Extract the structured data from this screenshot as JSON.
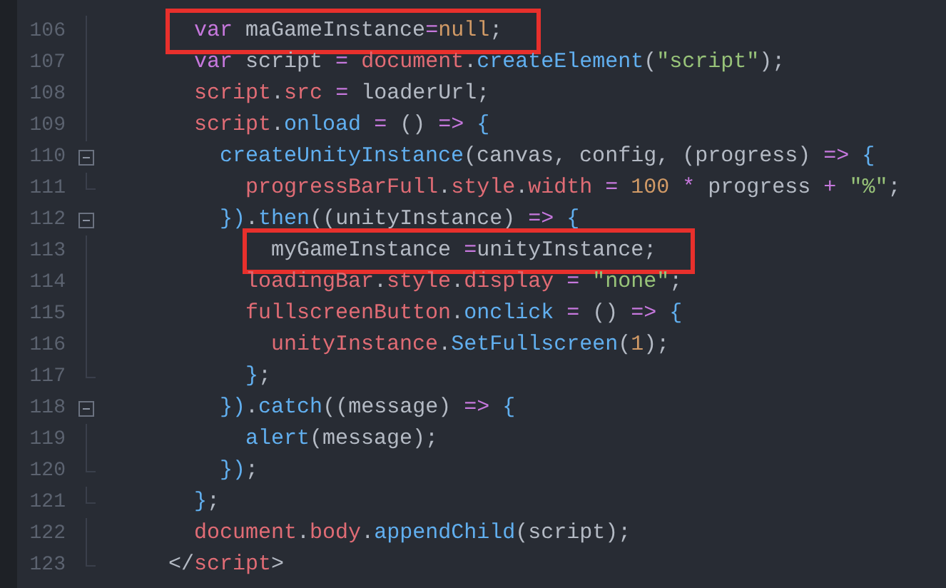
{
  "editor": {
    "lines": [
      {
        "number": "106",
        "kind": "line",
        "boxed": true,
        "tokens": [
          {
            "kind": "kw",
            "text": "      var"
          },
          {
            "kind": "plain",
            "text": " maGameInstance"
          },
          {
            "kind": "op",
            "text": "="
          },
          {
            "kind": "num",
            "text": "null"
          },
          {
            "kind": "plain",
            "text": ";"
          }
        ]
      },
      {
        "number": "107",
        "kind": "line",
        "boxed": false,
        "tokens": [
          {
            "kind": "kw",
            "text": "      var"
          },
          {
            "kind": "plain",
            "text": " script "
          },
          {
            "kind": "op",
            "text": "="
          },
          {
            "kind": "var",
            "text": " document"
          },
          {
            "kind": "plain",
            "text": "."
          },
          {
            "kind": "fn",
            "text": "createElement"
          },
          {
            "kind": "plain",
            "text": "("
          },
          {
            "kind": "str",
            "text": "\"script\""
          },
          {
            "kind": "plain",
            "text": ");"
          }
        ]
      },
      {
        "number": "108",
        "kind": "line",
        "boxed": false,
        "tokens": [
          {
            "kind": "var",
            "text": "      script"
          },
          {
            "kind": "plain",
            "text": "."
          },
          {
            "kind": "var",
            "text": "src"
          },
          {
            "kind": "op",
            "text": " ="
          },
          {
            "kind": "plain",
            "text": " loaderUrl;"
          }
        ]
      },
      {
        "number": "109",
        "kind": "line",
        "boxed": false,
        "tokens": [
          {
            "kind": "var",
            "text": "      script"
          },
          {
            "kind": "plain",
            "text": "."
          },
          {
            "kind": "fn",
            "text": "onload"
          },
          {
            "kind": "op",
            "text": " ="
          },
          {
            "kind": "plain",
            "text": " () "
          },
          {
            "kind": "op",
            "text": "=>"
          },
          {
            "kind": "fn",
            "text": " {"
          }
        ]
      },
      {
        "number": "110",
        "kind": "fold",
        "boxed": false,
        "tokens": [
          {
            "kind": "fn",
            "text": "        createUnityInstance"
          },
          {
            "kind": "plain",
            "text": "(canvas, config, (progress) "
          },
          {
            "kind": "op",
            "text": "=>"
          },
          {
            "kind": "fn",
            "text": " {"
          }
        ]
      },
      {
        "number": "111",
        "kind": "end",
        "boxed": false,
        "tokens": [
          {
            "kind": "var",
            "text": "          progressBarFull"
          },
          {
            "kind": "plain",
            "text": "."
          },
          {
            "kind": "var",
            "text": "style"
          },
          {
            "kind": "plain",
            "text": "."
          },
          {
            "kind": "var",
            "text": "width"
          },
          {
            "kind": "op",
            "text": " ="
          },
          {
            "kind": "num",
            "text": " 100"
          },
          {
            "kind": "op",
            "text": " *"
          },
          {
            "kind": "plain",
            "text": " progress "
          },
          {
            "kind": "op",
            "text": "+"
          },
          {
            "kind": "str",
            "text": " \"%\""
          },
          {
            "kind": "plain",
            "text": ";"
          }
        ]
      },
      {
        "number": "112",
        "kind": "fold",
        "boxed": false,
        "tokens": [
          {
            "kind": "fn",
            "text": "        })"
          },
          {
            "kind": "plain",
            "text": "."
          },
          {
            "kind": "fn",
            "text": "then"
          },
          {
            "kind": "plain",
            "text": "((unityInstance) "
          },
          {
            "kind": "op",
            "text": "=>"
          },
          {
            "kind": "fn",
            "text": " {"
          }
        ]
      },
      {
        "number": "113",
        "kind": "line",
        "boxed": true,
        "tokens": [
          {
            "kind": "plain",
            "text": "            myGameInstance "
          },
          {
            "kind": "op",
            "text": "="
          },
          {
            "kind": "plain",
            "text": "unityInstance;"
          }
        ]
      },
      {
        "number": "114",
        "kind": "line",
        "boxed": false,
        "tokens": [
          {
            "kind": "var",
            "text": "          loadingBar"
          },
          {
            "kind": "plain",
            "text": "."
          },
          {
            "kind": "var",
            "text": "style"
          },
          {
            "kind": "plain",
            "text": "."
          },
          {
            "kind": "var",
            "text": "display"
          },
          {
            "kind": "op",
            "text": " ="
          },
          {
            "kind": "str",
            "text": " \"none\""
          },
          {
            "kind": "plain",
            "text": ";"
          }
        ]
      },
      {
        "number": "115",
        "kind": "line",
        "boxed": false,
        "tokens": [
          {
            "kind": "var",
            "text": "          fullscreenButton"
          },
          {
            "kind": "plain",
            "text": "."
          },
          {
            "kind": "fn",
            "text": "onclick"
          },
          {
            "kind": "op",
            "text": " ="
          },
          {
            "kind": "plain",
            "text": " () "
          },
          {
            "kind": "op",
            "text": "=>"
          },
          {
            "kind": "fn",
            "text": " {"
          }
        ]
      },
      {
        "number": "116",
        "kind": "line",
        "boxed": false,
        "tokens": [
          {
            "kind": "var",
            "text": "            unityInstance"
          },
          {
            "kind": "plain",
            "text": "."
          },
          {
            "kind": "fn",
            "text": "SetFullscreen"
          },
          {
            "kind": "plain",
            "text": "("
          },
          {
            "kind": "num",
            "text": "1"
          },
          {
            "kind": "plain",
            "text": ");"
          }
        ]
      },
      {
        "number": "117",
        "kind": "end",
        "boxed": false,
        "tokens": [
          {
            "kind": "fn",
            "text": "          }"
          },
          {
            "kind": "plain",
            "text": ";"
          }
        ]
      },
      {
        "number": "118",
        "kind": "fold",
        "boxed": false,
        "tokens": [
          {
            "kind": "fn",
            "text": "        })"
          },
          {
            "kind": "plain",
            "text": "."
          },
          {
            "kind": "fn",
            "text": "catch"
          },
          {
            "kind": "plain",
            "text": "((message) "
          },
          {
            "kind": "op",
            "text": "=>"
          },
          {
            "kind": "fn",
            "text": " {"
          }
        ]
      },
      {
        "number": "119",
        "kind": "line",
        "boxed": false,
        "tokens": [
          {
            "kind": "fn",
            "text": "          alert"
          },
          {
            "kind": "plain",
            "text": "(message);"
          }
        ]
      },
      {
        "number": "120",
        "kind": "end",
        "boxed": false,
        "tokens": [
          {
            "kind": "fn",
            "text": "        })"
          },
          {
            "kind": "plain",
            "text": ";"
          }
        ]
      },
      {
        "number": "121",
        "kind": "end",
        "boxed": false,
        "tokens": [
          {
            "kind": "fn",
            "text": "      }"
          },
          {
            "kind": "plain",
            "text": ";"
          }
        ]
      },
      {
        "number": "122",
        "kind": "line",
        "boxed": false,
        "tokens": [
          {
            "kind": "var",
            "text": "      document"
          },
          {
            "kind": "plain",
            "text": "."
          },
          {
            "kind": "var",
            "text": "body"
          },
          {
            "kind": "plain",
            "text": "."
          },
          {
            "kind": "fn",
            "text": "appendChild"
          },
          {
            "kind": "plain",
            "text": "(script);"
          }
        ]
      },
      {
        "number": "123",
        "kind": "end",
        "boxed": false,
        "tokens": [
          {
            "kind": "plain",
            "text": "    </"
          },
          {
            "kind": "var",
            "text": "script"
          },
          {
            "kind": "plain",
            "text": ">"
          }
        ]
      }
    ]
  }
}
